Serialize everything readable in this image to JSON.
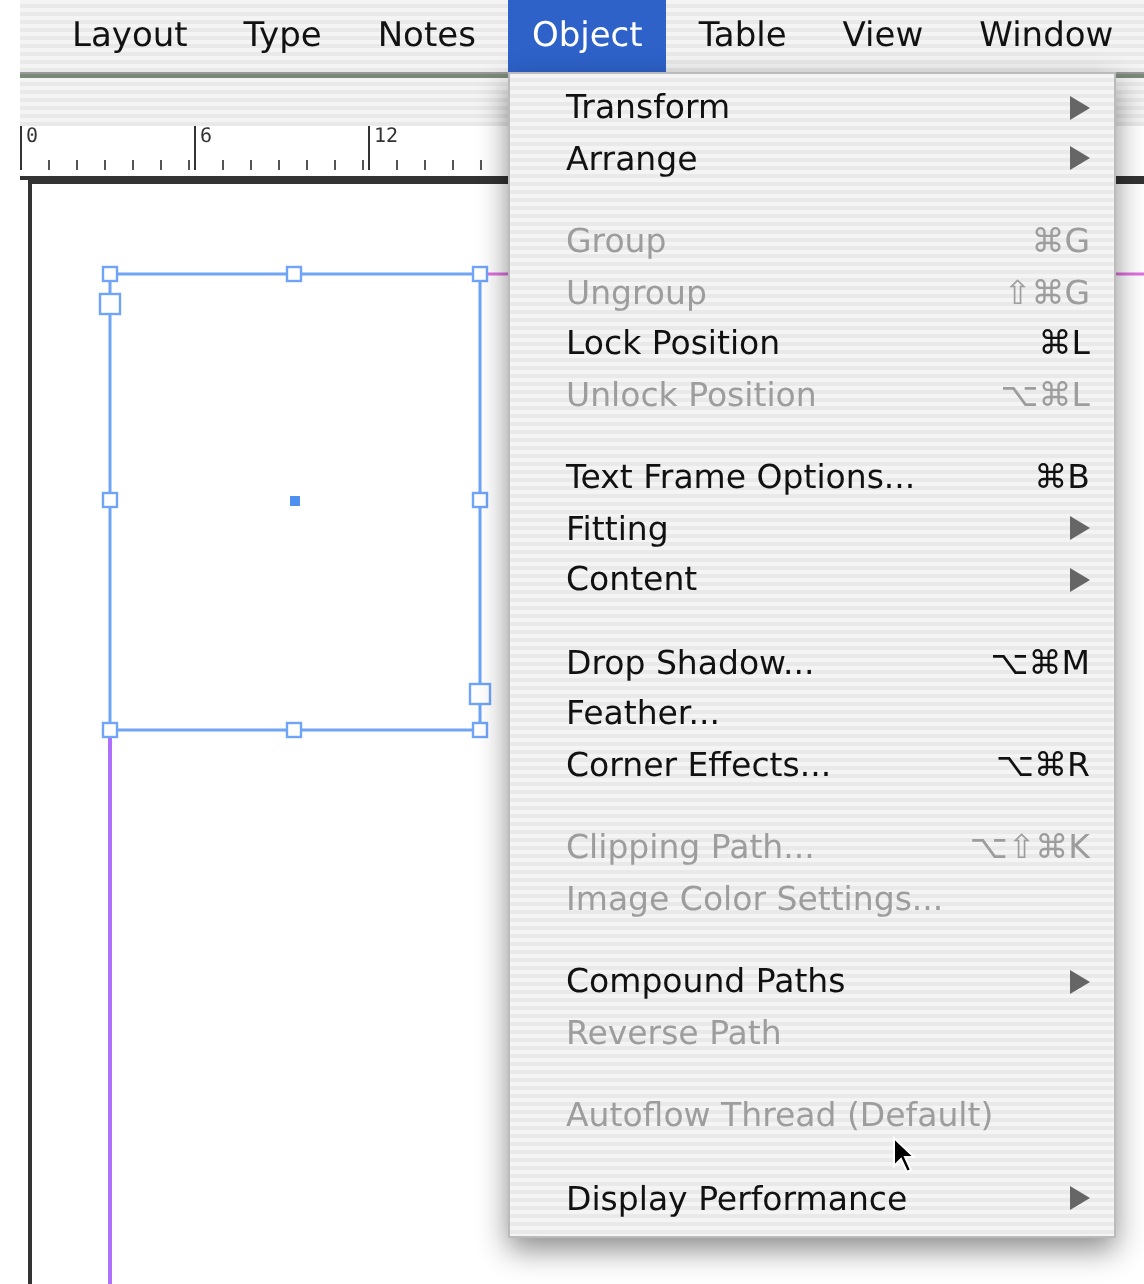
{
  "menubar": [
    {
      "label": "Layout",
      "selected": false
    },
    {
      "label": "Type",
      "selected": false
    },
    {
      "label": "Notes",
      "selected": false
    },
    {
      "label": "Object",
      "selected": true
    },
    {
      "label": "Table",
      "selected": false
    },
    {
      "label": "View",
      "selected": false
    },
    {
      "label": "Window",
      "selected": false
    }
  ],
  "ruler": {
    "labels": [
      "0",
      "6",
      "12"
    ]
  },
  "menu": {
    "groups": [
      [
        {
          "label": "Transform",
          "submenu": true,
          "disabled": false
        },
        {
          "label": "Arrange",
          "submenu": true,
          "disabled": false
        }
      ],
      [
        {
          "label": "Group",
          "shortcut": "⌘G",
          "submenu": false,
          "disabled": true
        },
        {
          "label": "Ungroup",
          "shortcut": "⇧⌘G",
          "submenu": false,
          "disabled": true
        },
        {
          "label": "Lock Position",
          "shortcut": "⌘L",
          "submenu": false,
          "disabled": false
        },
        {
          "label": "Unlock Position",
          "shortcut": "⌥⌘L",
          "submenu": false,
          "disabled": true
        }
      ],
      [
        {
          "label": "Text Frame Options...",
          "shortcut": "⌘B",
          "submenu": false,
          "disabled": false
        },
        {
          "label": "Fitting",
          "submenu": true,
          "disabled": false
        },
        {
          "label": "Content",
          "submenu": true,
          "disabled": false
        }
      ],
      [
        {
          "label": "Drop Shadow...",
          "shortcut": "⌥⌘M",
          "submenu": false,
          "disabled": false
        },
        {
          "label": "Feather...",
          "submenu": false,
          "disabled": false
        },
        {
          "label": "Corner Effects...",
          "shortcut": "⌥⌘R",
          "submenu": false,
          "disabled": false
        }
      ],
      [
        {
          "label": "Clipping Path...",
          "shortcut": "⌥⇧⌘K",
          "submenu": false,
          "disabled": true
        },
        {
          "label": "Image Color Settings...",
          "submenu": false,
          "disabled": true
        }
      ],
      [
        {
          "label": "Compound Paths",
          "submenu": true,
          "disabled": false
        },
        {
          "label": "Reverse Path",
          "submenu": false,
          "disabled": true
        }
      ],
      [
        {
          "label": "Autoflow Thread (Default)",
          "submenu": false,
          "disabled": true
        }
      ],
      [
        {
          "label": "Display Performance",
          "submenu": true,
          "disabled": false
        }
      ]
    ]
  }
}
